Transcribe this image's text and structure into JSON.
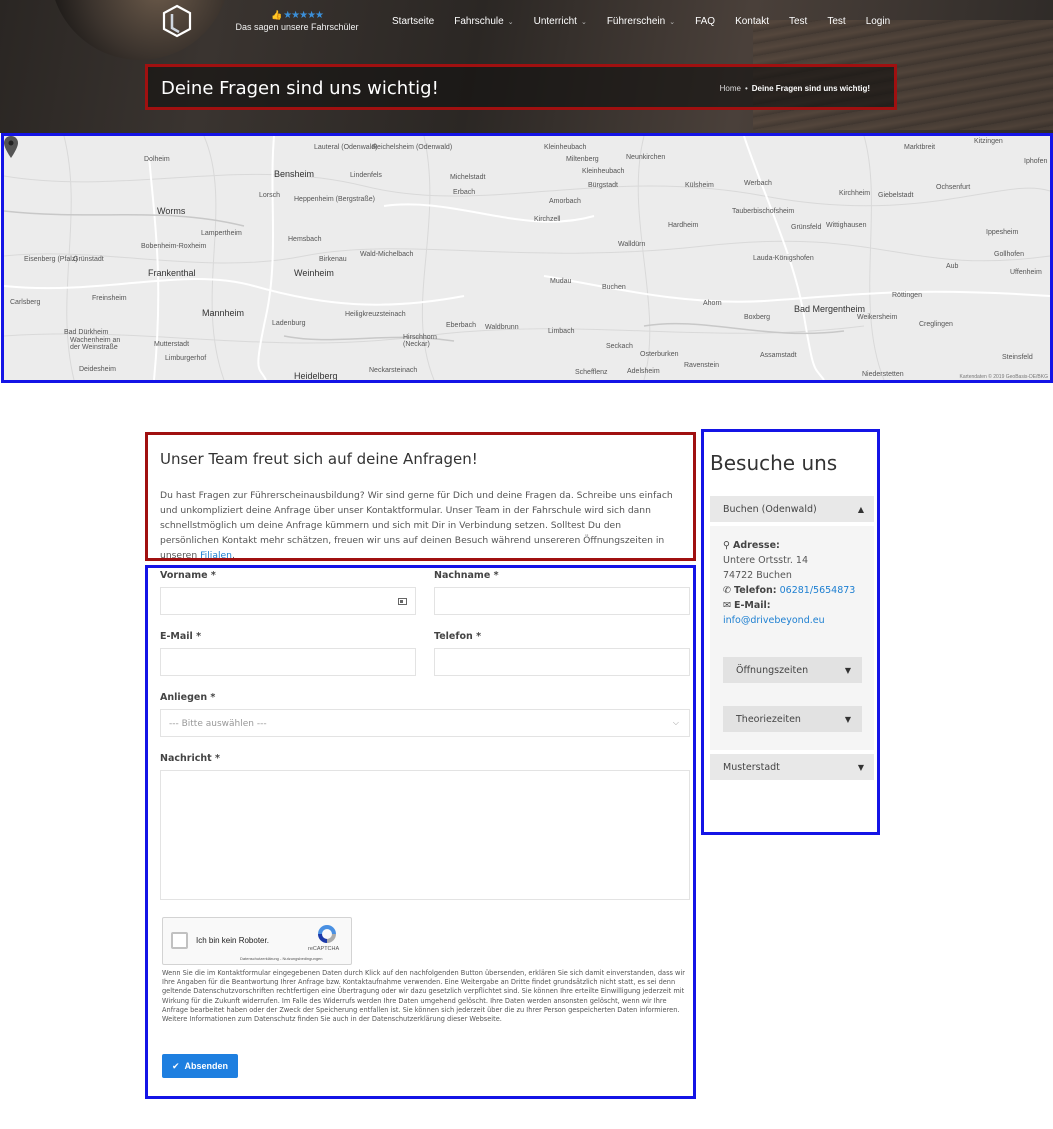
{
  "header": {
    "rating_stars": "★★★★★",
    "rating_text": "Das sagen unsere Fahrschüler",
    "nav": [
      {
        "label": "Startseite",
        "caret": ""
      },
      {
        "label": "Fahrschule",
        "caret": "⌄"
      },
      {
        "label": "Unterricht",
        "caret": "⌄"
      },
      {
        "label": "Führerschein",
        "caret": "⌄"
      },
      {
        "label": "FAQ",
        "caret": ""
      },
      {
        "label": "Kontakt",
        "caret": ""
      },
      {
        "label": "Test",
        "caret": ""
      },
      {
        "label": "Test",
        "caret": ""
      },
      {
        "label": "Login",
        "caret": ""
      }
    ],
    "page_title": "Deine Fragen sind uns wichtig!",
    "breadcrumb": {
      "home": "Home",
      "separator": "•",
      "current": "Deine Fragen sind uns wichtig!"
    }
  },
  "map": {
    "labels": [
      "Lauteral (Odenwald)",
      "Reichelsheim (Odenwald)",
      "Kleinheubach",
      "Miltenberg",
      "Neunkirchen",
      "Dolheim",
      "Bensheim",
      "Lindenfels",
      "Michelstadt",
      "Erbach",
      "Amorbach",
      "Külsheim",
      "Werbach",
      "Worms",
      "Lorsch",
      "Heppenheim (Bergstraße)",
      "Kirchzell",
      "Tauberbischofsheim",
      "Grünsfeld",
      "Wittighausen",
      "Lampertheim",
      "Hemsbach",
      "Walldürn",
      "Hardheim",
      "Lauda-Königshofen",
      "Bobenheim-Roxheim",
      "Frankenthal",
      "Weinheim",
      "Wald-Michelbach",
      "Birkenau",
      "Mudau",
      "Buchen",
      "Eisenberg (Pfalz)",
      "Grünstadt",
      "Freinsheim",
      "Mannheim",
      "Ladenburg",
      "Heiligkreuzsteinach",
      "Ahorn",
      "Boxberg",
      "Bad Mergentheim",
      "Weikersheim",
      "Creglingen",
      "Carlsberg",
      "Bad Dürkheim",
      "Wachenheim an der Weinstraße",
      "Mutterstadt",
      "Limburgerhof",
      "Hirschhorn (Neckar)",
      "Eberbach",
      "Waldbrunn",
      "Limbach",
      "Seckach",
      "Osterburken",
      "Ravenstein",
      "Assamstadt",
      "Deidesheim",
      "Heidelberg",
      "Neckarsteinach",
      "Schefflenz",
      "Adelsheim",
      "Niederstetten",
      "Steinsfeld",
      "Ochsenfurt",
      "Kirchheim",
      "Giebelstadt",
      "Röttingen",
      "Aub",
      "Gollhofen",
      "Uffenheim",
      "Ippesheim",
      "Iphofen",
      "Kitzingen",
      "Marktbreit",
      "Bürgstadt",
      "Kleinheubach"
    ],
    "attribution": "Kartendaten © 2019 GeoBasis-DE/BKG"
  },
  "intro": {
    "title": "Unser Team freut sich auf deine Anfragen!",
    "text": "Du hast Fragen zur Führerscheinausbildung? Wir sind gerne für Dich und deine Fragen da. Schreibe uns einfach und unkompliziert deine Anfrage über unser Kontaktformular. Unser Team in der Fahrschule wird sich dann schnellstmöglich um deine Anfrage kümmern und sich mit Dir in Verbindung setzen. Solltest Du den persönlichen Kontakt mehr schätzen, freuen wir uns auf deinen Besuch während unsereren Öffnungszeiten in unseren ",
    "link": "Filialen",
    "end": "."
  },
  "form": {
    "firstname_label": "Vorname *",
    "lastname_label": "Nachname *",
    "email_label": "E-Mail *",
    "phone_label": "Telefon *",
    "subject_label": "Anliegen *",
    "subject_placeholder": "--- Bitte auswählen ---",
    "message_label": "Nachricht *",
    "captcha_label": "Ich bin kein Roboter.",
    "captcha_brand": "reCAPTCHA",
    "captcha_links": "Datenschutzerklärung - Nutzungsbedingungen",
    "disclaimer": "Wenn Sie die im Kontaktformular eingegebenen Daten durch Klick auf den nachfolgenden Button übersenden, erklären Sie sich damit einverstanden, dass wir Ihre Angaben für die Beantwortung Ihrer Anfrage bzw. Kontaktaufnahme verwenden. Eine Weitergabe an Dritte findet grundsätzlich nicht statt, es sei denn geltende Datenschutzvorschriften rechtfertigen eine Übertragung oder wir dazu gesetzlich verpflichtet sind. Sie können Ihre erteilte Einwilligung jederzeit mit Wirkung für die Zukunft widerrufen. Im Falle des Widerrufs werden Ihre Daten umgehend gelöscht. Ihre Daten werden ansonsten gelöscht, wenn wir Ihre Anfrage bearbeitet haben oder der Zweck der Speicherung entfallen ist. Sie können sich jederzeit über die zu Ihrer Person gespeicherten Daten informieren. Weitere Informationen zum Datenschutz finden Sie auch in der Datenschutzerklärung dieser Webseite.",
    "submit_label": "Absenden"
  },
  "sidebar": {
    "title": "Besuche uns",
    "location1": "Buchen (Odenwald)",
    "address_label": "Adresse:",
    "street": "Untere Ortsstr. 14",
    "city": "74722 Buchen",
    "phone_label": "Telefon:",
    "phone": "06281/5654873",
    "email_label": "E-Mail:",
    "email": "info@drivebeyond.eu",
    "opening_hours": "Öffnungszeiten",
    "theory_times": "Theoriezeiten",
    "location2": "Musterstadt"
  },
  "colors": {
    "accent": "#1e7fe0",
    "link": "#1d7fd1",
    "highlight_red": "#a01010",
    "highlight_blue": "#1414e6"
  }
}
